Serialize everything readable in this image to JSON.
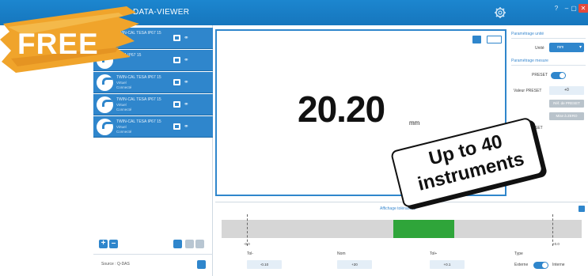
{
  "window": {
    "title": "DATA-VIEWER",
    "controls": [
      "?",
      "–",
      "▢",
      "✕"
    ]
  },
  "promo": {
    "free_label": "FREE",
    "callout_line1": "Up to 40",
    "callout_line2": "instruments",
    "ribbon_color": "#f0a42b"
  },
  "instruments": [
    {
      "name": "TWIN-CAL TESA IP67 15",
      "sub1": "",
      "sub2": ""
    },
    {
      "name": "TESA IP67 15",
      "sub1": "",
      "sub2": ""
    },
    {
      "name": "TWIN-CAL TESA IP67 15",
      "sub1": "Virtuel",
      "sub2": "Connecté"
    },
    {
      "name": "TWIN-CAL TESA IP67 15",
      "sub1": "Virtuel",
      "sub2": "Connecté"
    },
    {
      "name": "TWIN-CAL TESA IP67 15",
      "sub1": "Virtuel",
      "sub2": "Connecté"
    }
  ],
  "left_toolbar": {
    "add": "+",
    "remove": "–"
  },
  "source": {
    "label": "Source : Q-DAS"
  },
  "display": {
    "value": "20.20",
    "unit": "mm"
  },
  "settings": {
    "unit_section": "Paramétrage unité",
    "unit_label": "Unité",
    "unit_value": "mm",
    "measure_section": "Paramétrage mesure",
    "preset_label": "PRESET",
    "preset_value_label": "Valeur PRESET",
    "preset_value": "+0",
    "btn_ref_preset": "Réf. de PRESET",
    "btn_reset": "Mise à ZERO",
    "offset_label": "SET"
  },
  "tolerance": {
    "title": "Affichage tolérances",
    "left_marker": "-0.0",
    "right_marker": "+0.0",
    "tol_minus_label": "Tol-",
    "tol_minus_value": "-0.10",
    "nom_label": "Nom",
    "nom_value": "+20",
    "tol_plus_label": "Tol+",
    "tol_plus_value": "+0.1",
    "type_label": "Type",
    "type_externe": "Externe",
    "type_interne": "Interne"
  },
  "colors": {
    "accent": "#2f86cc",
    "titlebar": "#1676bd",
    "in_tolerance": "#2fa53a",
    "close": "#e14a3b"
  }
}
